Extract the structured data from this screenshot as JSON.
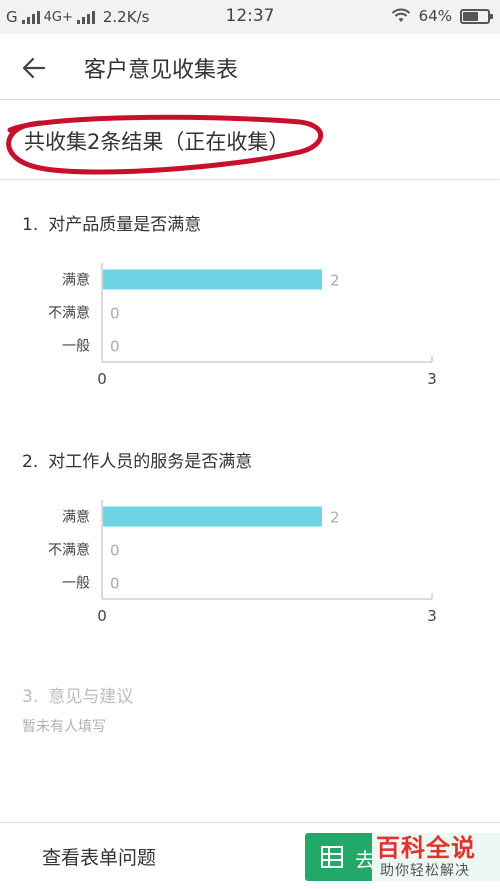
{
  "status_bar": {
    "carrier1": "G",
    "network": "4G+",
    "speed": "2.2K/s",
    "time": "12:37",
    "battery_text": "64%",
    "battery_level": 0.64
  },
  "header": {
    "title": "客户意见收集表"
  },
  "summary": {
    "text": "共收集2条结果（正在收集）"
  },
  "questions": [
    {
      "num": "1.",
      "title": "对产品质量是否满意"
    },
    {
      "num": "2.",
      "title": "对工作人员的服务是否满意"
    },
    {
      "num": "3.",
      "title": "意见与建议",
      "empty_text": "暂未有人填写"
    }
  ],
  "chart_data": [
    {
      "type": "bar",
      "orientation": "horizontal",
      "categories": [
        "满意",
        "不满意",
        "一般"
      ],
      "values": [
        2,
        0,
        0
      ],
      "value_labels": [
        "2",
        "0",
        "0"
      ],
      "xlim": [
        0,
        3
      ],
      "xticks": [
        "0",
        "3"
      ],
      "bar_color": "#6dd4e6"
    },
    {
      "type": "bar",
      "orientation": "horizontal",
      "categories": [
        "满意",
        "不满意",
        "一般"
      ],
      "values": [
        2,
        0,
        0
      ],
      "value_labels": [
        "2",
        "0",
        "0"
      ],
      "xlim": [
        0,
        3
      ],
      "xticks": [
        "0",
        "3"
      ],
      "bar_color": "#6dd4e6"
    }
  ],
  "bottom_bar": {
    "view_questions": "查看表单问题",
    "green_button": "去"
  },
  "watermark": {
    "main": "百科全说",
    "sub": "助你轻松解决"
  },
  "colors": {
    "accent_green": "#22a868",
    "annotation_red": "#c8102e",
    "bar": "#6dd4e6"
  }
}
